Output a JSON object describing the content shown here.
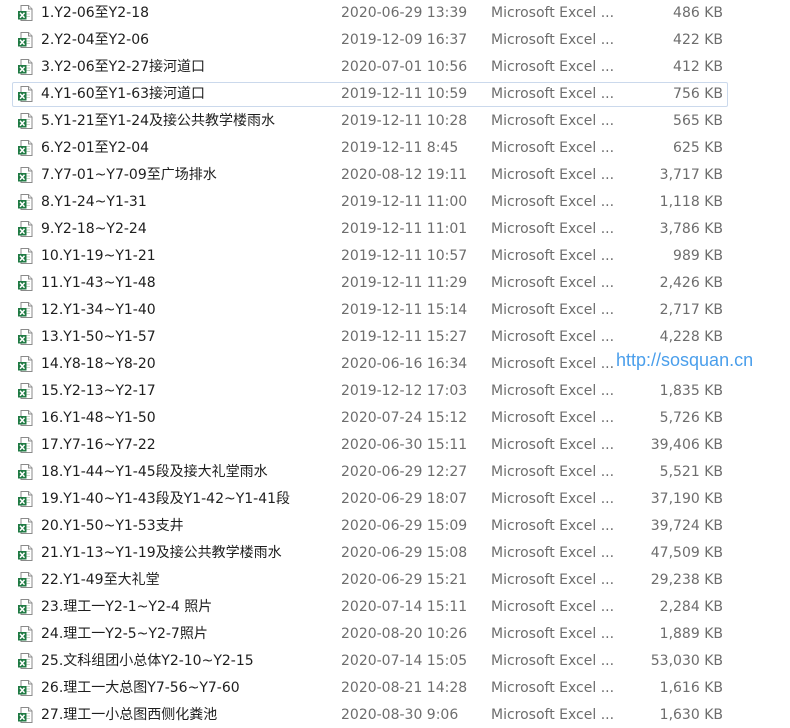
{
  "files": [
    {
      "name": "1.Y2-06至Y2-18",
      "date": "2020-06-29 13:39",
      "type": "Microsoft Excel ...",
      "size": "486 KB",
      "icon": "excel-file-icon"
    },
    {
      "name": "2.Y2-04至Y2-06",
      "date": "2019-12-09 16:37",
      "type": "Microsoft Excel ...",
      "size": "422 KB",
      "icon": "excel-file-icon"
    },
    {
      "name": "3.Y2-06至Y2-27接河道口",
      "date": "2020-07-01 10:56",
      "type": "Microsoft Excel ...",
      "size": "412 KB",
      "icon": "excel-file-icon"
    },
    {
      "name": "4.Y1-60至Y1-63接河道口",
      "date": "2019-12-11 10:59",
      "type": "Microsoft Excel ...",
      "size": "756 KB",
      "icon": "excel-file-icon",
      "selected": true
    },
    {
      "name": "5.Y1-21至Y1-24及接公共教学楼雨水",
      "date": "2019-12-11 10:28",
      "type": "Microsoft Excel ...",
      "size": "565 KB",
      "icon": "excel-file-icon"
    },
    {
      "name": "6.Y2-01至Y2-04",
      "date": "2019-12-11 8:45",
      "type": "Microsoft Excel ...",
      "size": "625 KB",
      "icon": "excel-file-icon"
    },
    {
      "name": "7.Y7-01~Y7-09至广场排水",
      "date": "2020-08-12 19:11",
      "type": "Microsoft Excel ...",
      "size": "3,717 KB",
      "icon": "excel-file-icon"
    },
    {
      "name": "8.Y1-24~Y1-31",
      "date": "2019-12-11 11:00",
      "type": "Microsoft Excel ...",
      "size": "1,118 KB",
      "icon": "excel-file-icon"
    },
    {
      "name": "9.Y2-18~Y2-24",
      "date": "2019-12-11 11:01",
      "type": "Microsoft Excel ...",
      "size": "3,786 KB",
      "icon": "excel-file-icon"
    },
    {
      "name": "10.Y1-19~Y1-21",
      "date": "2019-12-11 10:57",
      "type": "Microsoft Excel ...",
      "size": "989 KB",
      "icon": "excel-file-icon"
    },
    {
      "name": "11.Y1-43~Y1-48",
      "date": "2019-12-11 11:29",
      "type": "Microsoft Excel ...",
      "size": "2,426 KB",
      "icon": "excel-file-icon"
    },
    {
      "name": "12.Y1-34~Y1-40",
      "date": "2019-12-11 15:14",
      "type": "Microsoft Excel ...",
      "size": "2,717 KB",
      "icon": "excel-file-icon"
    },
    {
      "name": "13.Y1-50~Y1-57",
      "date": "2019-12-11 15:27",
      "type": "Microsoft Excel ...",
      "size": "4,228 KB",
      "icon": "excel-file-icon"
    },
    {
      "name": "14.Y8-18~Y8-20",
      "date": "2020-06-16 16:34",
      "type": "Microsoft Excel ...",
      "size": "",
      "icon": "excel-file-icon"
    },
    {
      "name": "15.Y2-13~Y2-17",
      "date": "2019-12-12 17:03",
      "type": "Microsoft Excel ...",
      "size": "1,835 KB",
      "icon": "excel-file-icon"
    },
    {
      "name": "16.Y1-48~Y1-50",
      "date": "2020-07-24 15:12",
      "type": "Microsoft Excel ...",
      "size": "5,726 KB",
      "icon": "excel-file-icon"
    },
    {
      "name": "17.Y7-16~Y7-22",
      "date": "2020-06-30 15:11",
      "type": "Microsoft Excel ...",
      "size": "39,406 KB",
      "icon": "excel-file-icon"
    },
    {
      "name": "18.Y1-44~Y1-45段及接大礼堂雨水",
      "date": "2020-06-29 12:27",
      "type": "Microsoft Excel ...",
      "size": "5,521 KB",
      "icon": "excel-file-icon"
    },
    {
      "name": "19.Y1-40~Y1-43段及Y1-42~Y1-41段",
      "date": "2020-06-29 18:07",
      "type": "Microsoft Excel ...",
      "size": "37,190 KB",
      "icon": "excel-file-icon"
    },
    {
      "name": "20.Y1-50~Y1-53支井",
      "date": "2020-06-29 15:09",
      "type": "Microsoft Excel ...",
      "size": "39,724 KB",
      "icon": "excel-file-icon"
    },
    {
      "name": "21.Y1-13~Y1-19及接公共教学楼雨水",
      "date": "2020-06-29 15:08",
      "type": "Microsoft Excel ...",
      "size": "47,509 KB",
      "icon": "excel-file-icon"
    },
    {
      "name": "22.Y1-49至大礼堂",
      "date": "2020-06-29 15:21",
      "type": "Microsoft Excel ...",
      "size": "29,238 KB",
      "icon": "excel-file-icon"
    },
    {
      "name": "23.理工一Y2-1~Y2-4 照片",
      "date": "2020-07-14 15:11",
      "type": "Microsoft Excel ...",
      "size": "2,284 KB",
      "icon": "excel-file-icon"
    },
    {
      "name": "24.理工一Y2-5~Y2-7照片",
      "date": "2020-08-20 10:26",
      "type": "Microsoft Excel ...",
      "size": "1,889 KB",
      "icon": "excel-file-icon"
    },
    {
      "name": "25.文科组团小总体Y2-10~Y2-15",
      "date": "2020-07-14 15:05",
      "type": "Microsoft Excel ...",
      "size": "53,030 KB",
      "icon": "excel-file-icon"
    },
    {
      "name": "26.理工一大总图Y7-56~Y7-60",
      "date": "2020-08-21 14:28",
      "type": "Microsoft Excel ...",
      "size": "1,616 KB",
      "icon": "excel-file-icon"
    },
    {
      "name": "27.理工一小总图西侧化粪池",
      "date": "2020-08-30 9:06",
      "type": "Microsoft Excel ...",
      "size": "1,630 KB",
      "icon": "excel-file-icon"
    }
  ],
  "watermark": {
    "text": "http://sosquan.cn",
    "color": "#2b8ee8"
  },
  "colors": {
    "excel_green": "#1f7a43",
    "selection_border": "#cbd9ec",
    "meta_text": "#6d6d6d"
  }
}
